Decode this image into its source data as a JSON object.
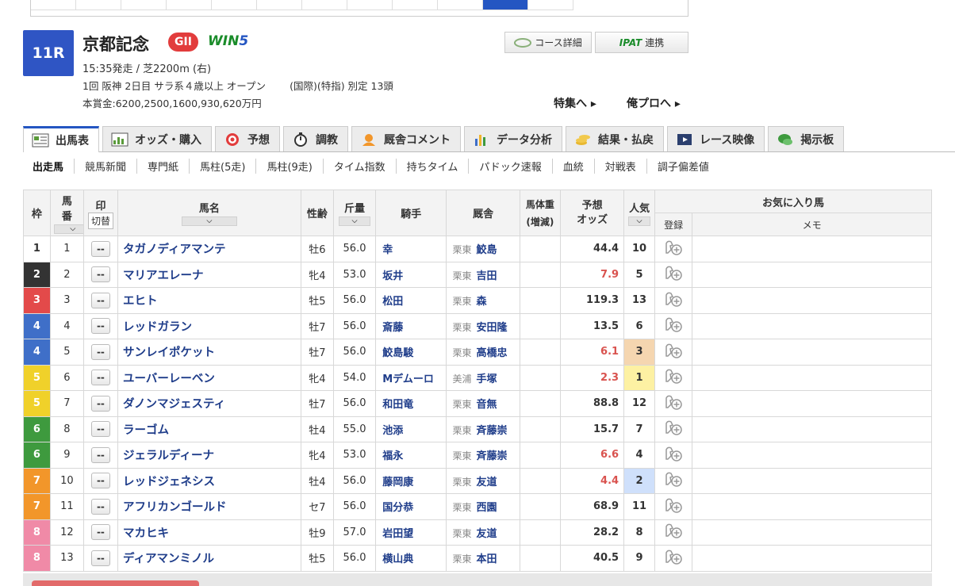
{
  "race": {
    "number": "11R",
    "name": "京都記念",
    "grade": "GII",
    "win5_a": "WIN",
    "win5_b": "5",
    "line1": "15:35発走 / 芝2200m (右)",
    "line2a": "1回 阪神 2日目 サラ系４歳以上 オープン",
    "line2b": "(国際)(特指) 別定 13頭",
    "prize": "本賞金:6200,2500,1600,930,620万円"
  },
  "header_buttons": {
    "course": "コース詳細",
    "ipat": "IPAT",
    "renkei": "連携"
  },
  "links": {
    "tokushu": "特集へ ▸",
    "orepro": "俺プロへ ▸"
  },
  "main_tabs": [
    "出馬表",
    "オッズ・購入",
    "予想",
    "調教",
    "厩舎コメント",
    "データ分析",
    "結果・払戻",
    "レース映像",
    "掲示板"
  ],
  "sub_nav": [
    "出走馬",
    "競馬新聞",
    "専門紙",
    "馬柱(5走)",
    "馬柱(9走)",
    "タイム指数",
    "持ちタイム",
    "パドック速報",
    "血統",
    "対戦表",
    "調子偏差値"
  ],
  "columns": {
    "waku": "枠",
    "umaban_a": "馬",
    "umaban_b": "番",
    "mark": "印",
    "kirikae": "切替",
    "horse": "馬名",
    "sex": "性齢",
    "weight": "斤量",
    "jockey": "騎手",
    "trainer": "厩舎",
    "body_a": "馬体重",
    "body_b": "(増減)",
    "odds_a": "予想",
    "odds_b": "オッズ",
    "pop": "人気",
    "fav": "お気に入り馬",
    "reg": "登録",
    "memo": "メモ",
    "sort": "⌵"
  },
  "mark_label": "--",
  "rows": [
    {
      "waku": "1",
      "uma": "1",
      "horse": "タガノディアマンテ",
      "sex": "牡6",
      "weight": "56.0",
      "jockey": "幸",
      "region": "栗東",
      "trainer": "鮫島",
      "odds": "44.4",
      "pop": "10",
      "hot": false
    },
    {
      "waku": "2",
      "uma": "2",
      "horse": "マリアエレーナ",
      "sex": "牝4",
      "weight": "53.0",
      "jockey": "坂井",
      "region": "栗東",
      "trainer": "吉田",
      "odds": "7.9",
      "pop": "5",
      "hot": true
    },
    {
      "waku": "3",
      "uma": "3",
      "horse": "エヒト",
      "sex": "牡5",
      "weight": "56.0",
      "jockey": "松田",
      "region": "栗東",
      "trainer": "森",
      "odds": "119.3",
      "pop": "13",
      "hot": false
    },
    {
      "waku": "4",
      "uma": "4",
      "horse": "レッドガラン",
      "sex": "牡7",
      "weight": "56.0",
      "jockey": "斎藤",
      "region": "栗東",
      "trainer": "安田隆",
      "odds": "13.5",
      "pop": "6",
      "hot": false
    },
    {
      "waku": "4",
      "uma": "5",
      "horse": "サンレイポケット",
      "sex": "牡7",
      "weight": "56.0",
      "jockey": "鮫島駿",
      "region": "栗東",
      "trainer": "高橋忠",
      "odds": "6.1",
      "pop": "3",
      "hot": true
    },
    {
      "waku": "5",
      "uma": "6",
      "horse": "ユーバーレーベン",
      "sex": "牝4",
      "weight": "54.0",
      "jockey": "Mデムーロ",
      "region": "美浦",
      "trainer": "手塚",
      "odds": "2.3",
      "pop": "1",
      "hot": true
    },
    {
      "waku": "5",
      "uma": "7",
      "horse": "ダノンマジェスティ",
      "sex": "牡7",
      "weight": "56.0",
      "jockey": "和田竜",
      "region": "栗東",
      "trainer": "音無",
      "odds": "88.8",
      "pop": "12",
      "hot": false
    },
    {
      "waku": "6",
      "uma": "8",
      "horse": "ラーゴム",
      "sex": "牡4",
      "weight": "55.0",
      "jockey": "池添",
      "region": "栗東",
      "trainer": "斉藤崇",
      "odds": "15.7",
      "pop": "7",
      "hot": false
    },
    {
      "waku": "6",
      "uma": "9",
      "horse": "ジェラルディーナ",
      "sex": "牝4",
      "weight": "53.0",
      "jockey": "福永",
      "region": "栗東",
      "trainer": "斉藤崇",
      "odds": "6.6",
      "pop": "4",
      "hot": true
    },
    {
      "waku": "7",
      "uma": "10",
      "horse": "レッドジェネシス",
      "sex": "牡4",
      "weight": "56.0",
      "jockey": "藤岡康",
      "region": "栗東",
      "trainer": "友道",
      "odds": "4.4",
      "pop": "2",
      "hot": true
    },
    {
      "waku": "7",
      "uma": "11",
      "horse": "アフリカンゴールド",
      "sex": "セ7",
      "weight": "56.0",
      "jockey": "国分恭",
      "region": "栗東",
      "trainer": "西園",
      "odds": "68.9",
      "pop": "11",
      "hot": false
    },
    {
      "waku": "8",
      "uma": "12",
      "horse": "マカヒキ",
      "sex": "牡9",
      "weight": "57.0",
      "jockey": "岩田望",
      "region": "栗東",
      "trainer": "友道",
      "odds": "28.2",
      "pop": "8",
      "hot": false
    },
    {
      "waku": "8",
      "uma": "13",
      "horse": "ディアマンミノル",
      "sex": "牡5",
      "weight": "56.0",
      "jockey": "横山典",
      "region": "栗東",
      "trainer": "本田",
      "odds": "40.5",
      "pop": "9",
      "hot": false
    }
  ]
}
